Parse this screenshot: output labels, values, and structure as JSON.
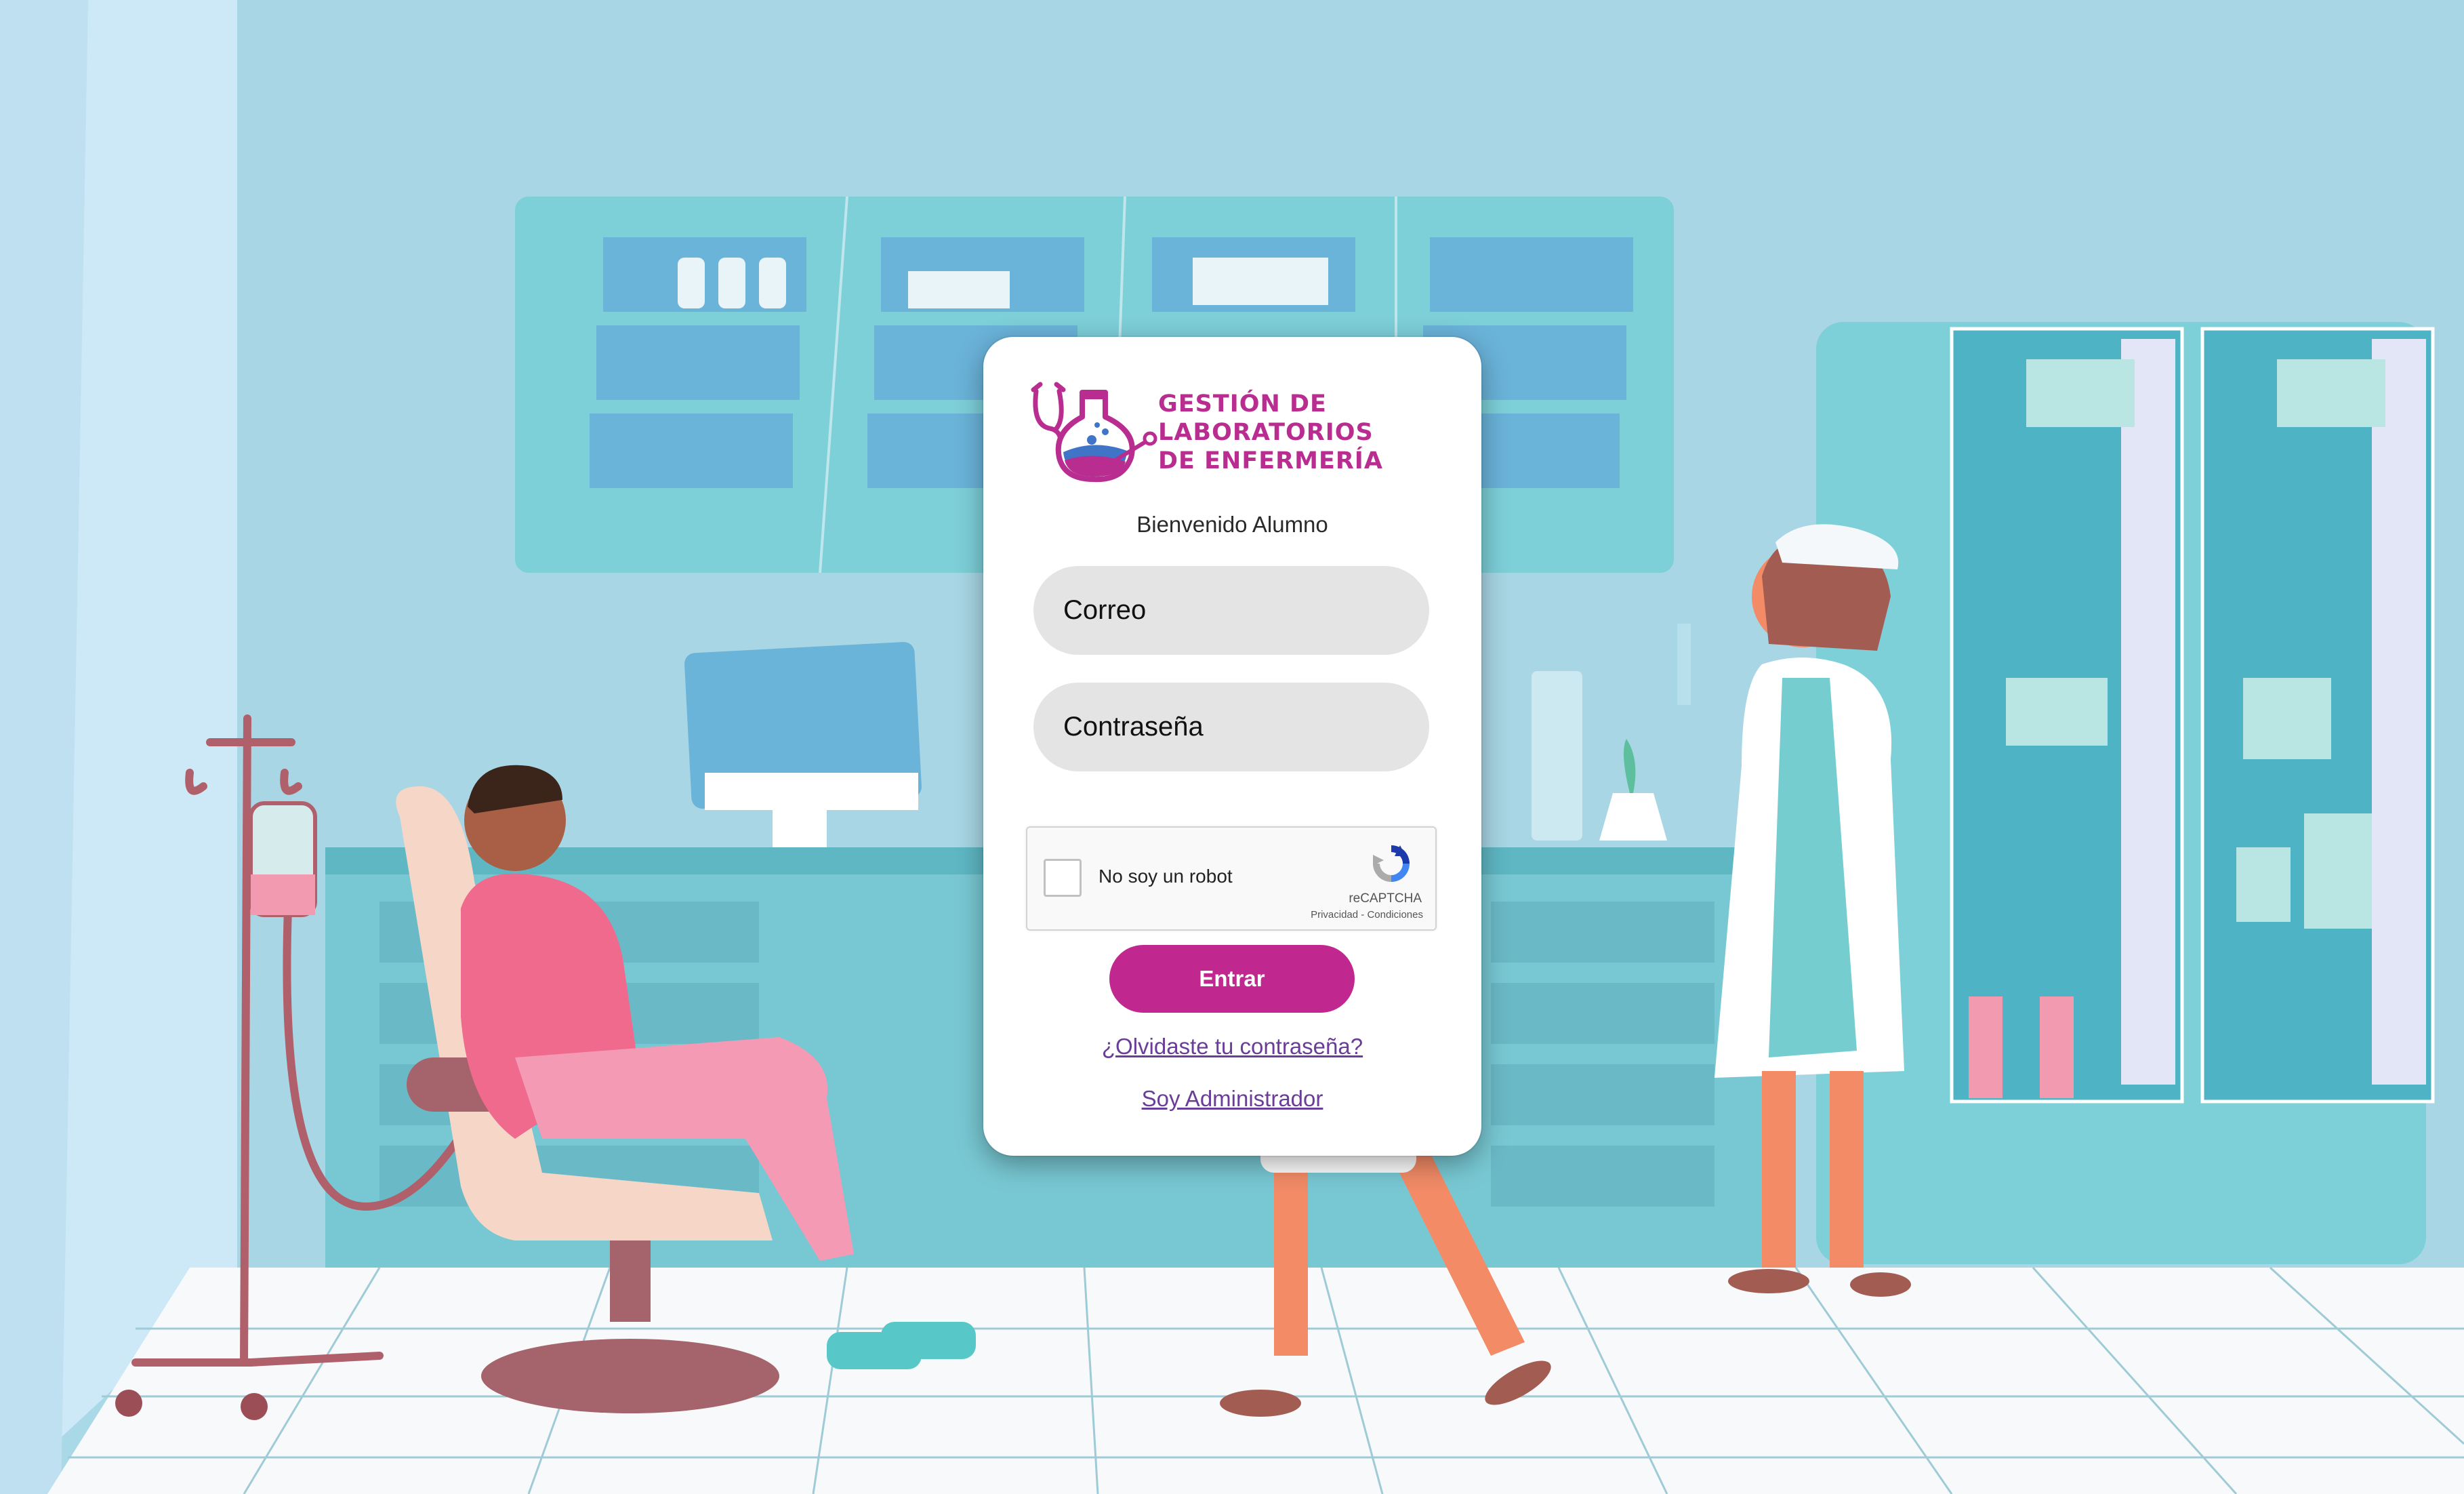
{
  "brand": {
    "logo_line1": "GESTIÓN DE",
    "logo_line2": "LABORATORIOS",
    "logo_line3": "DE ENFERMERÍA",
    "color_primary": "#b82d8f",
    "color_flask": "#3f74c7",
    "logo_icon": "stethoscope-flask-icon"
  },
  "login": {
    "welcome_text": "Bienvenido Alumno",
    "email_placeholder": "Correo",
    "password_placeholder": "Contraseña",
    "submit_label": "Entrar",
    "forgot_link": "¿Olvidaste tu contraseña?",
    "admin_link": "Soy Administrador",
    "button_color": "#c0288f",
    "link_color": "#6a3d98"
  },
  "recaptcha": {
    "label": "No soy un robot",
    "brand": "reCAPTCHA",
    "links": "Privacidad - Condiciones",
    "icon": "recaptcha-icon"
  },
  "background": {
    "scene": "nursing-clinic-illustration"
  }
}
